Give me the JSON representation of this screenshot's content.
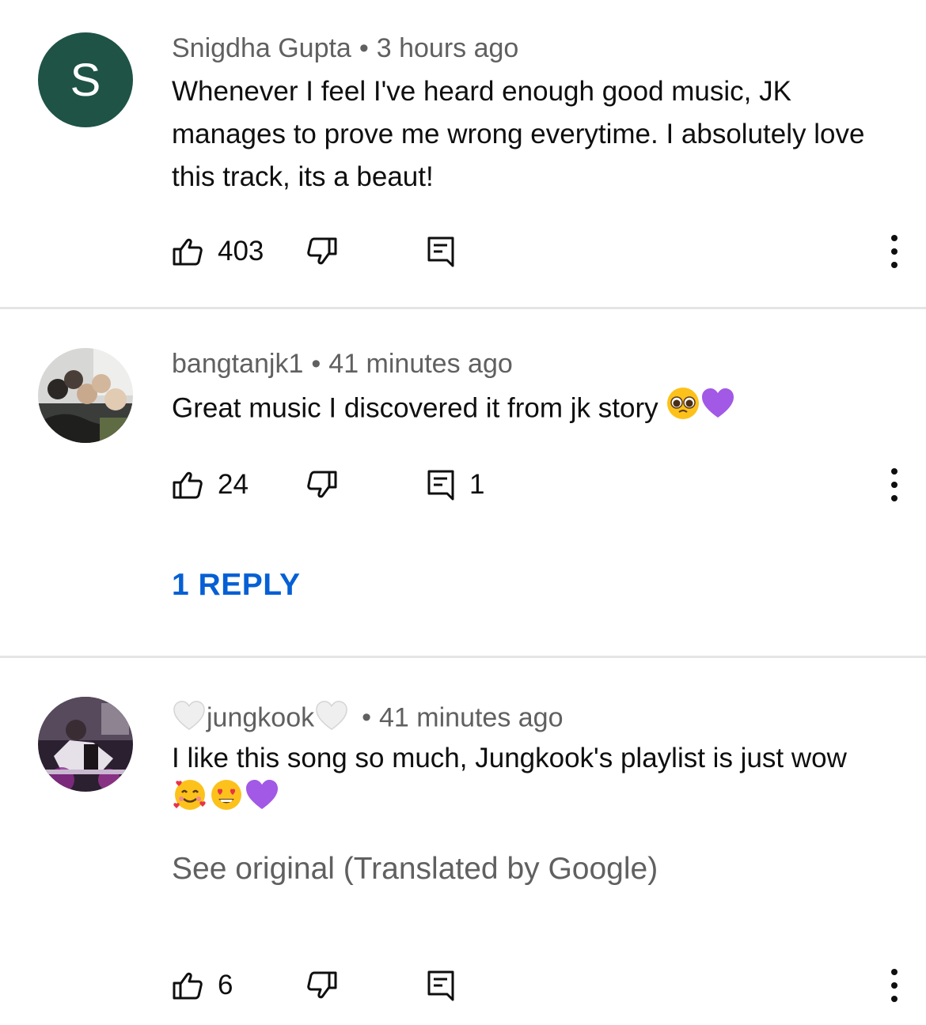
{
  "comments": [
    {
      "avatar_letter": "S",
      "author": "Snigdha Gupta",
      "time": "3 hours ago",
      "text": "Whenever I feel I've heard enough good music, JK manages to prove me wrong everytime. I absolutely love this track, its a beaut!",
      "likes": "403",
      "replies_count": ""
    },
    {
      "author": "bangtanjk1",
      "time": "41 minutes ago",
      "text": "Great music I discovered it from jk story",
      "likes": "24",
      "replies_count": "1",
      "view_replies": "1 REPLY"
    },
    {
      "author": "jungkook",
      "time": "41 minutes ago",
      "text": "I like this song so much, Jungkook's playlist is just wow",
      "translation_note": "See original (Translated by Google)",
      "likes": "6",
      "replies_count": ""
    }
  ],
  "colors": {
    "meta": "#606060",
    "link": "#065fd4",
    "divider": "#e5e5e5",
    "avatar_s": "#1e5346"
  }
}
